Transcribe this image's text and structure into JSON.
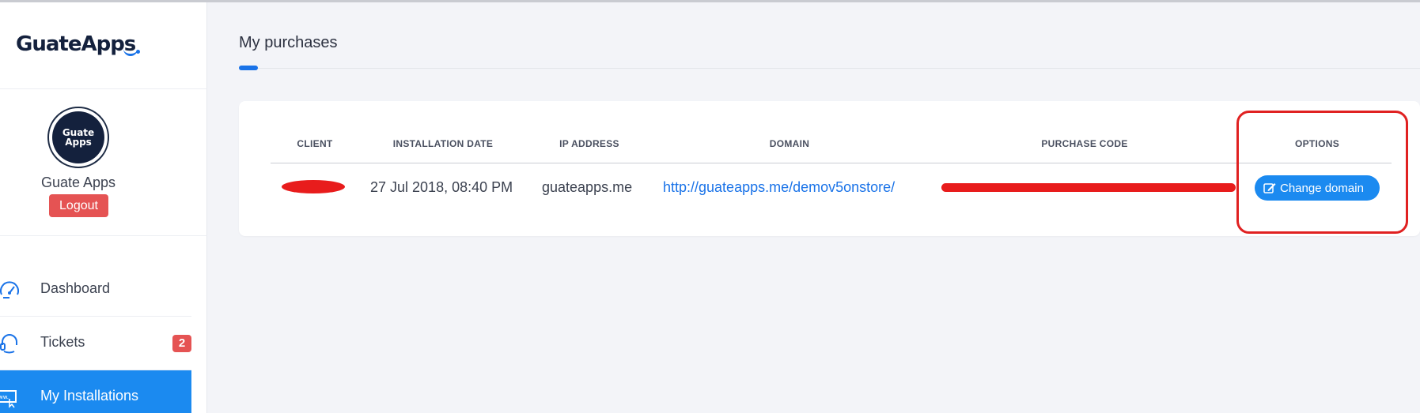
{
  "brand": {
    "logo_text": "GuateApps"
  },
  "profile": {
    "avatar_line1": "Guate",
    "avatar_line2": "Apps",
    "name": "Guate Apps",
    "logout_label": "Logout"
  },
  "nav": {
    "items": [
      {
        "label": "Dashboard",
        "icon": "speedometer-icon"
      },
      {
        "label": "Tickets",
        "icon": "headset-icon",
        "badge": "2"
      },
      {
        "label": "My Installations",
        "icon": "web-installation-icon",
        "active": true
      }
    ]
  },
  "page": {
    "title": "My purchases"
  },
  "table": {
    "headers": [
      "CLIENT",
      "INSTALLATION DATE",
      "IP ADDRESS",
      "DOMAIN",
      "PURCHASE CODE",
      "OPTIONS"
    ],
    "rows": [
      {
        "client": "[redacted]",
        "installation_date": "27 Jul 2018, 08:40 PM",
        "ip_address": "guateapps.me",
        "domain": "http://guateapps.me/demov5onstore/",
        "purchase_code": "[redacted]",
        "option_label": "Change domain"
      }
    ]
  },
  "colors": {
    "primary": "#1b8af0",
    "danger": "#e55353",
    "annotation": "#e02121"
  }
}
